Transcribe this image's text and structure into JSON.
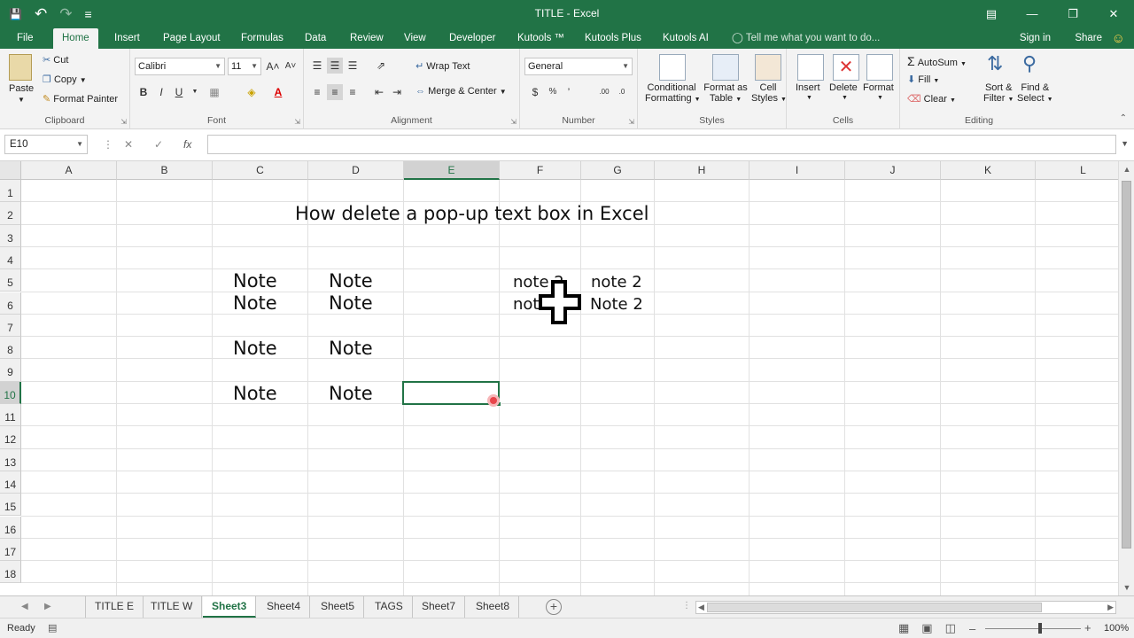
{
  "window": {
    "title": "TITLE - Excel",
    "minimize": "—",
    "restore": "❐",
    "close": "✕",
    "ribbon_options": "▤"
  },
  "qat": {
    "save": "💾",
    "undo": "↶",
    "redo": "↷",
    "customize": "≡"
  },
  "tabs": [
    "File",
    "Home",
    "Insert",
    "Page Layout",
    "Formulas",
    "Data",
    "Review",
    "View",
    "Developer",
    "Kutools ™",
    "Kutools Plus",
    "Kutools AI"
  ],
  "active_tab": "Home",
  "tell_me": "Tell me what you want to do...",
  "signin": "Sign in",
  "share": "Share",
  "smiley": "☺",
  "ribbon": {
    "clipboard": {
      "label": "Clipboard",
      "paste": "Paste",
      "cut": "Cut",
      "copy": "Copy",
      "format_painter": "Format Painter"
    },
    "font": {
      "label": "Font",
      "name": "Calibri",
      "size": "11",
      "bold": "B",
      "italic": "I",
      "underline": "U",
      "grow": "A˄",
      "shrink": "A˅"
    },
    "alignment": {
      "label": "Alignment",
      "wrap": "Wrap Text",
      "merge": "Merge & Center"
    },
    "number": {
      "label": "Number",
      "format": "General",
      "currency": "$",
      "percent": "%",
      "comma": "’",
      "inc": ".00",
      "dec": ".0"
    },
    "styles": {
      "label": "Styles",
      "conditional": "Conditional",
      "conditional2": "Formatting",
      "format_table": "Format as",
      "format_table2": "Table",
      "cell_styles": "Cell",
      "cell_styles2": "Styles"
    },
    "cells": {
      "label": "Cells",
      "insert": "Insert",
      "delete": "Delete",
      "format": "Format"
    },
    "editing": {
      "label": "Editing",
      "autosum": "AutoSum",
      "fill": "Fill",
      "clear": "Clear",
      "sort": "Sort &",
      "sort2": "Filter",
      "find": "Find &",
      "find2": "Select"
    }
  },
  "formula_bar": {
    "name_box": "E10",
    "cancel": "✕",
    "enter": "✓",
    "fx": "fx",
    "value": ""
  },
  "columns": [
    "A",
    "B",
    "C",
    "D",
    "E",
    "F",
    "G",
    "H",
    "I",
    "J",
    "K",
    "L"
  ],
  "rows": [
    "1",
    "2",
    "3",
    "4",
    "5",
    "6",
    "7",
    "8",
    "9",
    "10",
    "11",
    "12",
    "13",
    "14",
    "15",
    "16",
    "17",
    "18"
  ],
  "cells": {
    "title": "How delete a pop-up text box in Excel",
    "c5": "Note",
    "d5": "Note",
    "f5": "note 2",
    "g5": "note 2",
    "c6": "Note",
    "d6": "Note",
    "f6": "not",
    "g6": "Note 2",
    "c8": "Note",
    "d8": "Note",
    "c10": "Note",
    "d10": "Note"
  },
  "selected_cell": "E10",
  "sheets": [
    "TITLE E",
    "TITLE W",
    "Sheet3",
    "Sheet4",
    "Sheet5",
    "TAGS",
    "Sheet7",
    "Sheet8"
  ],
  "active_sheet": "Sheet3",
  "status": {
    "ready": "Ready",
    "zoom": "100%",
    "zoom_minus": "–",
    "zoom_plus": "+"
  },
  "colors": {
    "excel_green": "#217346",
    "ribbon_bg": "#f3f3f3",
    "selection": "#217346",
    "record_dot": "#e8454b"
  }
}
